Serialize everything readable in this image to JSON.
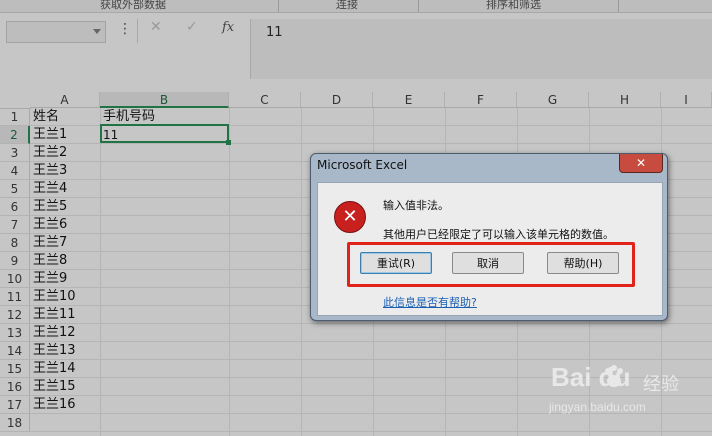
{
  "ribbon": {
    "groups": [
      "获取外部数据",
      "连接",
      "排序和筛选"
    ]
  },
  "formula_bar": {
    "name_box": "",
    "cancel_glyph": "✕",
    "enter_glyph": "✓",
    "fx_label": "fx",
    "value": "11"
  },
  "sheet": {
    "columns": [
      "A",
      "B",
      "C",
      "D",
      "E",
      "F",
      "G",
      "H",
      "I"
    ],
    "rows": [
      "1",
      "2",
      "3",
      "4",
      "5",
      "6",
      "7",
      "8",
      "9",
      "10",
      "11",
      "12",
      "13",
      "14",
      "15",
      "16",
      "17",
      "18"
    ],
    "col_a": [
      "姓名",
      "王兰1",
      "王兰2",
      "王兰3",
      "王兰4",
      "王兰5",
      "王兰6",
      "王兰7",
      "王兰8",
      "王兰9",
      "王兰10",
      "王兰11",
      "王兰12",
      "王兰13",
      "王兰14",
      "王兰15",
      "王兰16",
      ""
    ],
    "col_b": [
      "手机号码",
      "11"
    ]
  },
  "dialog": {
    "title": "Microsoft Excel",
    "close_glyph": "✕",
    "icon": "error-x-icon",
    "message": "输入值非法。",
    "detail": "其他用户已经限定了可以输入该单元格的数值。",
    "buttons": {
      "retry": "重试(R)",
      "cancel": "取消",
      "help": "帮助(H)"
    },
    "help_link": "此信息是否有帮助?"
  },
  "watermark": {
    "brand": "Bai  du",
    "brand_cn": "经验",
    "url": "jingyan.baidu.com"
  },
  "colors": {
    "excel_green": "#217346",
    "highlight_red": "#e2231a",
    "error_red": "#c8201f",
    "link_blue": "#1a5fb4"
  }
}
